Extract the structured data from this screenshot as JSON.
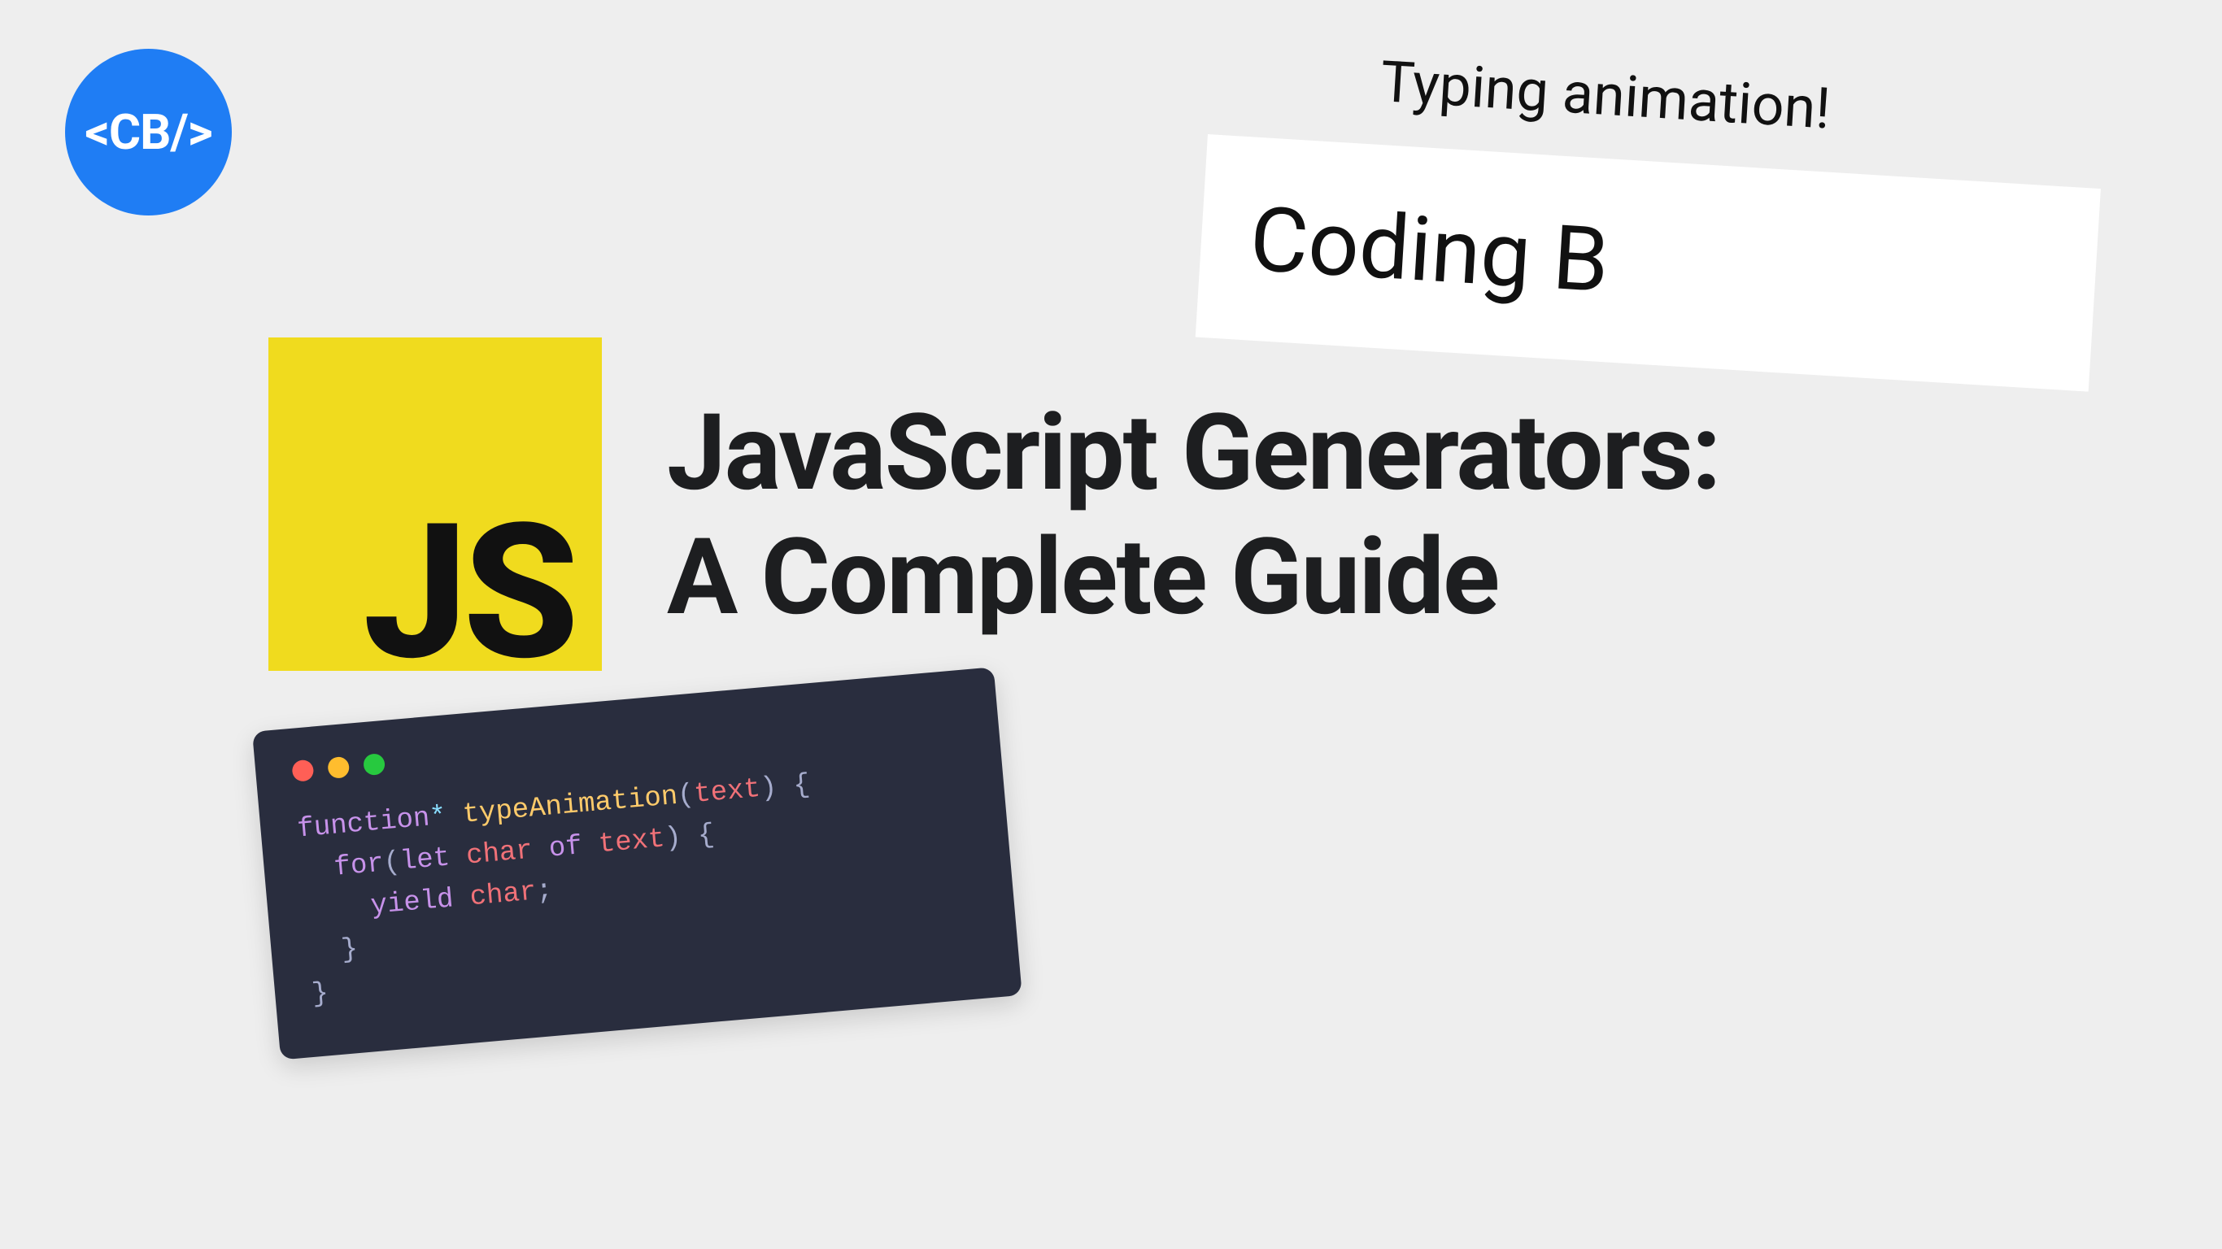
{
  "logo": {
    "text": "<CB/>"
  },
  "typing": {
    "label": "Typing animation!",
    "card_text": "Coding B"
  },
  "badge": {
    "text": "JS"
  },
  "title": {
    "line1": "JavaScript Generators:",
    "line2": "A Complete Guide"
  },
  "code": {
    "kw_function": "function",
    "star": "*",
    "func_name": "typeAnimation",
    "paren_open": "(",
    "param": "text",
    "paren_close": ")",
    "brace_open": "{",
    "kw_for": "for",
    "kw_let": "let",
    "var_char": "char",
    "kw_of": "of",
    "iter_text": "text",
    "kw_yield": "yield",
    "yield_char": "char",
    "semicolon": ";",
    "brace_close": "}"
  }
}
